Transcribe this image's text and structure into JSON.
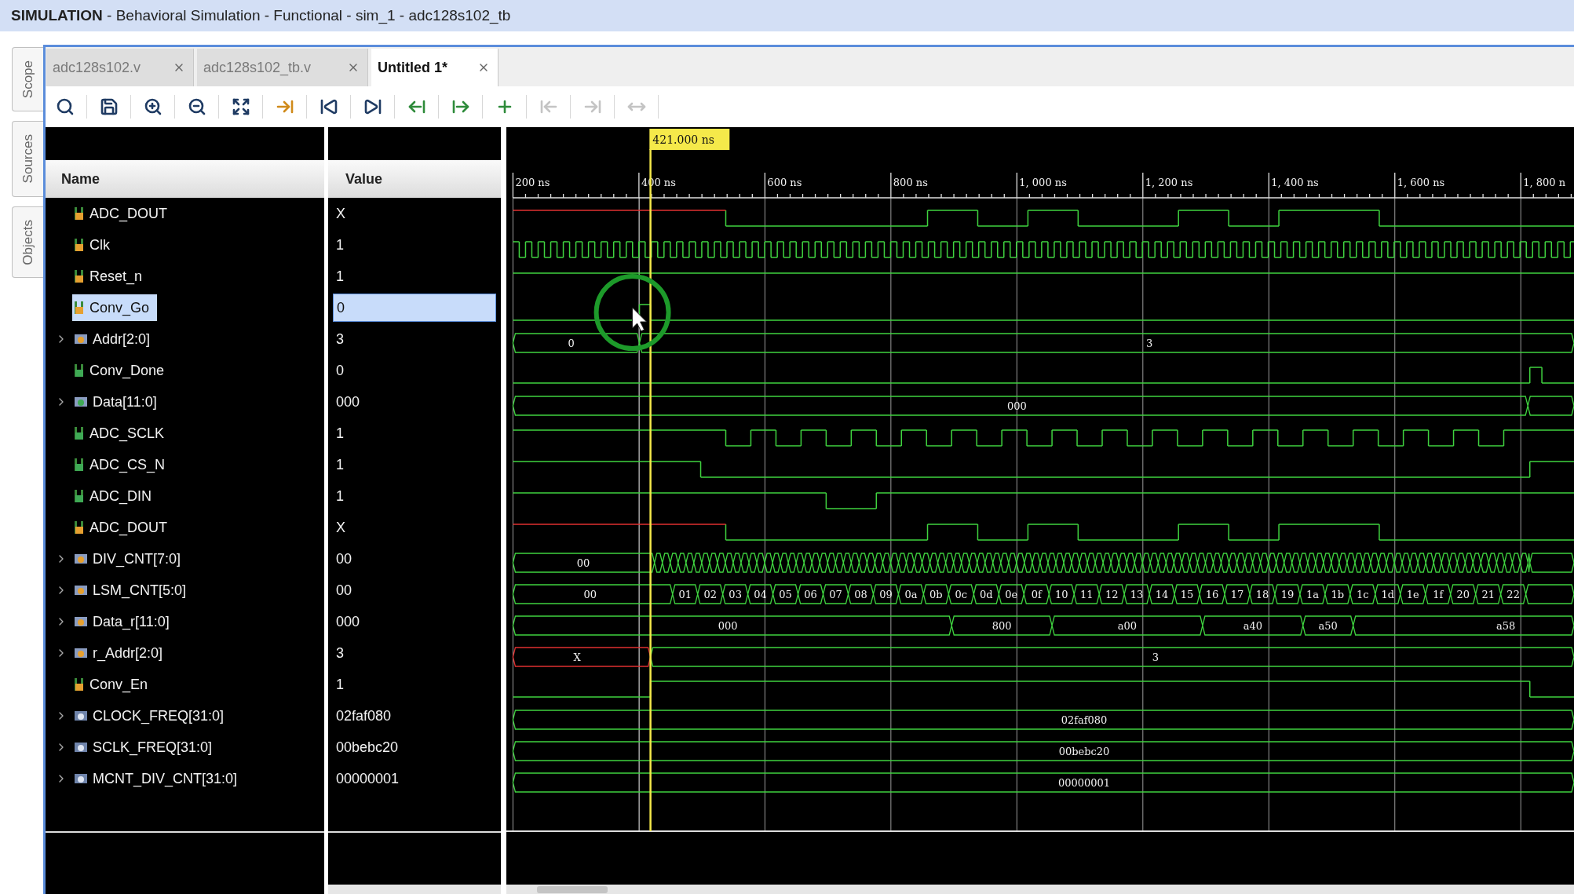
{
  "window": {
    "title": "**SIMULATION** - Behavioral Simulation - Functional - sim_1 - adc128s102_tb"
  },
  "side_tabs": [
    "Scope",
    "Sources",
    "Objects"
  ],
  "tabs": [
    {
      "label": "adc128s102.v",
      "selected": false
    },
    {
      "label": "adc128s102_tb.v",
      "selected": false
    },
    {
      "label": "Untitled 1*",
      "selected": true
    }
  ],
  "toolbar": [
    {
      "kind": "search",
      "disabled": false
    },
    {
      "kind": "save",
      "disabled": false
    },
    {
      "kind": "zoom-in",
      "disabled": false
    },
    {
      "kind": "zoom-out",
      "disabled": false
    },
    {
      "kind": "zoom-fit",
      "disabled": false
    },
    {
      "kind": "go-to-cursor",
      "disabled": false
    },
    {
      "kind": "go-to-start",
      "disabled": false
    },
    {
      "kind": "go-to-end",
      "disabled": false
    },
    {
      "kind": "previous-transition",
      "disabled": false
    },
    {
      "kind": "next-transition",
      "disabled": false
    },
    {
      "kind": "add-marker",
      "disabled": false
    },
    {
      "kind": "previous-marker",
      "disabled": true
    },
    {
      "kind": "next-marker",
      "disabled": true
    },
    {
      "kind": "swap-cursors",
      "disabled": true
    }
  ],
  "columns": {
    "name": "Name",
    "value": "Value"
  },
  "cursor": {
    "label": "421.000 ns"
  },
  "timeline": {
    "ticks": [
      "200 ns",
      "400 ns",
      "600 ns",
      "800 ns",
      "1, 000 ns",
      "1, 200 ns",
      "1, 400 ns",
      "1, 600 ns",
      "1, 800 n"
    ]
  },
  "signals": [
    {
      "name": "ADC_DOUT",
      "value": "X",
      "kind": "bit",
      "color": "#e6a030",
      "selected": false
    },
    {
      "name": "Clk",
      "value": "1",
      "kind": "bit",
      "color": "#e6a030",
      "selected": false
    },
    {
      "name": "Reset_n",
      "value": "1",
      "kind": "bit",
      "color": "#e6a030",
      "selected": false
    },
    {
      "name": "Conv_Go",
      "value": "0",
      "kind": "bit",
      "color": "#e6a030",
      "selected": true
    },
    {
      "name": "Addr[2:0]",
      "value": "3",
      "kind": "bus",
      "color": "#e6a030",
      "selected": false,
      "expanded": false,
      "wave_labels": [
        "0",
        "3"
      ]
    },
    {
      "name": "Conv_Done",
      "value": "0",
      "kind": "bit",
      "color": "#3faa55",
      "selected": false
    },
    {
      "name": "Data[11:0]",
      "value": "000",
      "kind": "bus",
      "color": "#3faa55",
      "selected": false,
      "expanded": false,
      "wave_labels": [
        "000"
      ]
    },
    {
      "name": "ADC_SCLK",
      "value": "1",
      "kind": "bit",
      "color": "#3faa55",
      "selected": false
    },
    {
      "name": "ADC_CS_N",
      "value": "1",
      "kind": "bit",
      "color": "#3faa55",
      "selected": false
    },
    {
      "name": "ADC_DIN",
      "value": "1",
      "kind": "bit",
      "color": "#3faa55",
      "selected": false
    },
    {
      "name": "ADC_DOUT",
      "value": "X",
      "kind": "bit",
      "color": "#e6a030",
      "selected": false
    },
    {
      "name": "DIV_CNT[7:0]",
      "value": "00",
      "kind": "bus",
      "color": "#e6a030",
      "selected": false,
      "expanded": false,
      "wave_labels": [
        "00"
      ]
    },
    {
      "name": "LSM_CNT[5:0]",
      "value": "00",
      "kind": "bus",
      "color": "#e6a030",
      "selected": false,
      "expanded": false,
      "wave_labels": [
        "00",
        "01",
        "02",
        "03",
        "04",
        "05",
        "06",
        "07",
        "08",
        "09",
        "0a",
        "0b",
        "0c",
        "0d",
        "0e",
        "0f",
        "10",
        "11",
        "12",
        "13",
        "14",
        "15",
        "16",
        "17",
        "18",
        "19",
        "1a",
        "1b",
        "1c",
        "1d",
        "1e",
        "1f",
        "20",
        "21",
        "22"
      ]
    },
    {
      "name": "Data_r[11:0]",
      "value": "000",
      "kind": "bus",
      "color": "#e6a030",
      "selected": false,
      "expanded": false,
      "wave_labels": [
        "000",
        "800",
        "a00",
        "a40",
        "a50",
        "a58"
      ]
    },
    {
      "name": "r_Addr[2:0]",
      "value": "3",
      "kind": "bus",
      "color": "#e6a030",
      "selected": false,
      "expanded": false,
      "wave_labels": [
        "X",
        "3"
      ]
    },
    {
      "name": "Conv_En",
      "value": "1",
      "kind": "bit",
      "color": "#e6a030",
      "selected": false
    },
    {
      "name": "CLOCK_FREQ[31:0]",
      "value": "02faf080",
      "kind": "param",
      "color": "#dfe6f2",
      "selected": false,
      "expanded": false,
      "wave_labels": [
        "02faf080"
      ]
    },
    {
      "name": "SCLK_FREQ[31:0]",
      "value": "00bebc20",
      "kind": "param",
      "color": "#dfe6f2",
      "selected": false,
      "expanded": false,
      "wave_labels": [
        "00bebc20"
      ]
    },
    {
      "name": "MCNT_DIV_CNT[31:0]",
      "value": "00000001",
      "kind": "param",
      "color": "#dfe6f2",
      "selected": false,
      "expanded": false,
      "wave_labels": [
        "00000001"
      ]
    }
  ]
}
